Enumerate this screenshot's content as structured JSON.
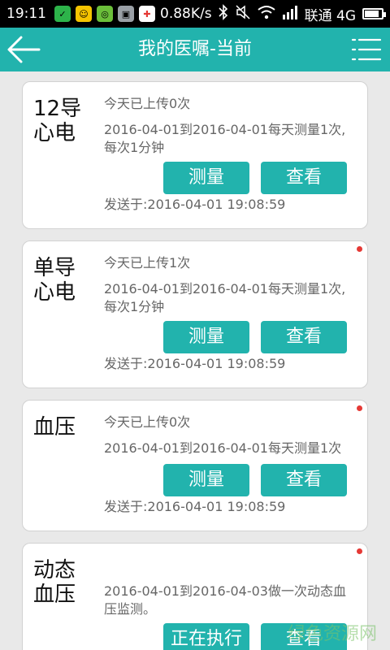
{
  "status_bar": {
    "time": "19:11",
    "speed": "0.88K/s",
    "carrier": "联通 4G",
    "battery_percent": 85
  },
  "header": {
    "title": "我的医嘱-当前"
  },
  "cards": [
    {
      "type": "12导\n心电",
      "uploaded": "今天已上传0次",
      "schedule": "2016-04-01到2016-04-01每天测量1次,\n每次1分钟",
      "measure_label": "测量",
      "view_label": "查看",
      "sent": "发送于:2016-04-01 19:08:59",
      "new": false
    },
    {
      "type": "单导\n心电",
      "uploaded": "今天已上传1次",
      "schedule": "2016-04-01到2016-04-01每天测量1次,\n每次1分钟",
      "measure_label": "测量",
      "view_label": "查看",
      "sent": "发送于:2016-04-01 19:08:59",
      "new": true
    },
    {
      "type": "血压",
      "uploaded": "今天已上传0次",
      "schedule": "2016-04-01到2016-04-01每天测量1次",
      "measure_label": "测量",
      "view_label": "查看",
      "sent": "发送于:2016-04-01 19:08:59",
      "new": true
    },
    {
      "type": "动态\n血压",
      "schedule": "2016-04-01到2016-04-03做一次动态血\n压监测。",
      "executing_label": "正在执行",
      "view_label": "查看",
      "new": true
    }
  ],
  "watermark": "绿色资源网"
}
